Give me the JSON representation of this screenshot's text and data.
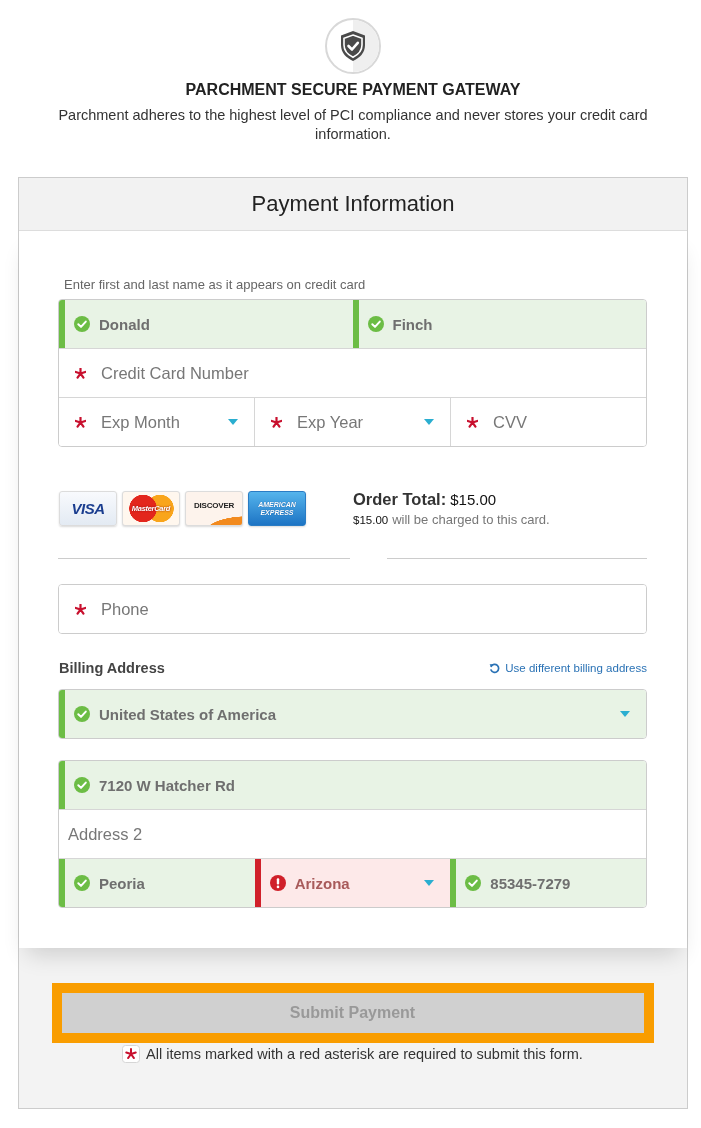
{
  "header": {
    "title": "PARCHMENT SECURE PAYMENT GATEWAY",
    "subtitle": "Parchment adheres to the highest level of PCI compliance and never stores your credit card information."
  },
  "panel": {
    "title": "Payment Information"
  },
  "name_hint": "Enter first and last name as it appears on credit card",
  "card_fields": [
    [
      {
        "kind": "text",
        "value": "Donald",
        "valid": true,
        "invalid": false,
        "required": false
      },
      {
        "kind": "text",
        "value": "Finch",
        "valid": true,
        "invalid": false,
        "required": false
      }
    ],
    [
      {
        "kind": "text",
        "placeholder": "Credit Card Number",
        "valid": false,
        "invalid": false,
        "required": true
      }
    ],
    [
      {
        "kind": "select",
        "placeholder": "Exp Month",
        "valid": false,
        "invalid": false,
        "required": true
      },
      {
        "kind": "select",
        "placeholder": "Exp Year",
        "valid": false,
        "invalid": false,
        "required": true
      },
      {
        "kind": "text",
        "placeholder": "CVV",
        "valid": false,
        "invalid": false,
        "required": true
      }
    ]
  ],
  "accepted_cards": [
    {
      "kind": "visa",
      "label": "VISA"
    },
    {
      "kind": "mastercard",
      "label": "MasterCard"
    },
    {
      "kind": "discover",
      "label": "DISCOVER"
    },
    {
      "kind": "amex",
      "label": "AMERICAN EXPRESS"
    }
  ],
  "order_total": {
    "label": "Order Total:",
    "amount": "$15.00",
    "charge_amount": "$15.00",
    "charge_note": "will be charged to this card."
  },
  "blank_fields": [
    {
      "kind": "underline"
    },
    {
      "kind": "underline"
    }
  ],
  "phone_fields": [
    [
      {
        "kind": "text",
        "placeholder": "Phone",
        "valid": false,
        "invalid": false,
        "required": true
      }
    ]
  ],
  "billing": {
    "label": "Billing Address",
    "link": "Use different billing address"
  },
  "country_fields": [
    [
      {
        "kind": "select",
        "value": "United States of America",
        "valid": true,
        "invalid": false,
        "required": false
      }
    ]
  ],
  "address_fields": [
    [
      {
        "kind": "text",
        "value": "7120 W Hatcher Rd",
        "valid": true,
        "invalid": false,
        "required": false
      }
    ],
    [
      {
        "kind": "text",
        "placeholder": "Address 2",
        "valid": false,
        "invalid": false,
        "required": false
      }
    ],
    [
      {
        "kind": "text",
        "value": "Peoria",
        "valid": true,
        "invalid": false,
        "required": false
      },
      {
        "kind": "select",
        "value": "Arizona",
        "valid": false,
        "invalid": true,
        "required": false
      },
      {
        "kind": "text",
        "value": "85345-7279",
        "valid": true,
        "invalid": false,
        "required": false
      }
    ]
  ],
  "submit": {
    "label": "Submit Payment",
    "disabled": true,
    "focused": true
  },
  "required_note": "All items marked with a red asterisk are required to submit this form."
}
